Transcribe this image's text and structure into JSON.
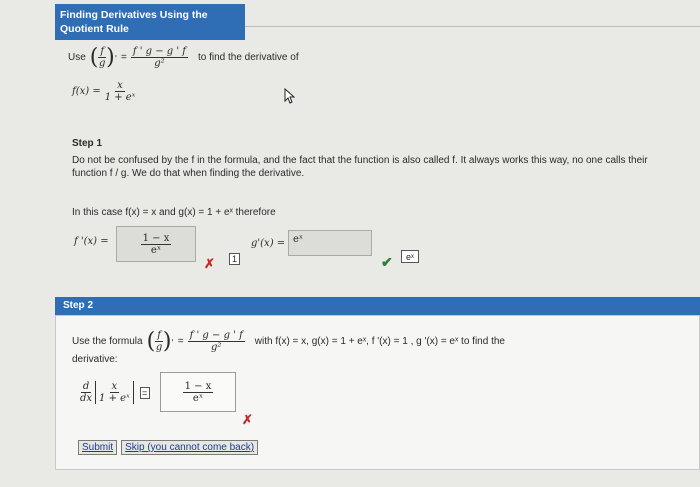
{
  "header": {
    "title": "Finding Derivatives Using the Quotient Rule"
  },
  "intro": {
    "use_label": "Use",
    "fraction_num": "f",
    "fraction_den": "g",
    "prime": "'",
    "equals": "=",
    "formula_num": "f ' g − g ' f",
    "formula_den": "g²",
    "instruction": "to find the derivative of",
    "function_lhs": "f(x) =",
    "function_num": "x",
    "function_den": "1 + eˣ"
  },
  "step1": {
    "title": "Step 1",
    "note": "Do not be confused by the f in the formula, and the fact that the function is also called f. It always works this way, no one calls their function f / g. We do that when finding the derivative.",
    "case_text": "In this case  f(x) = x  and  g(x) = 1 + eˣ  therefore",
    "fprime_label": "f '(x) =",
    "fprime_input_num": "1 − x",
    "fprime_input_den": "eˣ",
    "fprime_status": "✗",
    "fprime_feedback": "1",
    "gprime_label": "g'(x) =",
    "gprime_input": "eˣ",
    "gprime_status": "✔",
    "gprime_feedback": "eˣ"
  },
  "step2": {
    "title": "Step 2",
    "use_formula": "Use the formula",
    "with_text": "with f(x) = x, g(x) = 1 + eˣ, f '(x) = 1 , g '(x) = eˣ  to find the",
    "derivative_label": "derivative:",
    "ddx_num": "d",
    "ddx_den": "dx",
    "bracket_num": "x",
    "bracket_den": "1 + eˣ",
    "equals": "=",
    "answer_num": "1 − x",
    "answer_den": "eˣ",
    "status": "✗",
    "submit_label": "Submit",
    "skip_label": "Skip (you cannot come back)"
  }
}
